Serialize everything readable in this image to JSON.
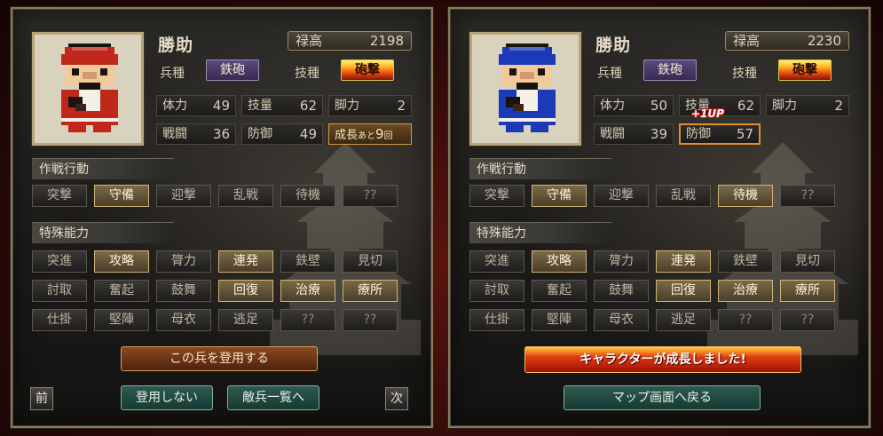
{
  "screens": [
    {
      "name": "勝助",
      "stipend": {
        "label": "禄高",
        "value": "2198"
      },
      "unit_type": {
        "label": "兵種",
        "value": "鉄砲"
      },
      "skill": {
        "label": "技種",
        "value": "砲撃"
      },
      "stats": [
        {
          "label": "体力",
          "value": "49"
        },
        {
          "label": "技量",
          "value": "62"
        },
        {
          "label": "脚力",
          "value": "2"
        },
        {
          "label": "戦闘",
          "value": "36"
        },
        {
          "label": "防御",
          "value": "49"
        }
      ],
      "growth": {
        "text": "成長",
        "small": "あと",
        "count": "9",
        "unit": "回"
      },
      "tactics_title": "作戦行動",
      "tactics": [
        "突撃",
        "守備",
        "迎撃",
        "乱戦",
        "待機",
        "??"
      ],
      "tactics_active": [
        1
      ],
      "abilities_title": "特殊能力",
      "abilities": [
        "突進",
        "攻略",
        "膂力",
        "連発",
        "鉄壁",
        "見切",
        "討取",
        "奮起",
        "鼓舞",
        "回復",
        "治療",
        "療所",
        "仕掛",
        "堅陣",
        "母衣",
        "逃足",
        "??",
        "??"
      ],
      "abilities_active": [
        1,
        3,
        9,
        10,
        11
      ],
      "buttons": {
        "recruit": "この兵を登用する",
        "decline": "登用しない",
        "enemy_list": "敵兵一覧へ",
        "prev": "前",
        "next": "次"
      },
      "colors": {
        "uniform": "#c0281c"
      }
    },
    {
      "name": "勝助",
      "stipend": {
        "label": "禄高",
        "value": "2230"
      },
      "unit_type": {
        "label": "兵種",
        "value": "鉄砲"
      },
      "skill": {
        "label": "技種",
        "value": "砲撃"
      },
      "stats": [
        {
          "label": "体力",
          "value": "50"
        },
        {
          "label": "技量",
          "value": "62"
        },
        {
          "label": "脚力",
          "value": "2"
        },
        {
          "label": "戦闘",
          "value": "39"
        },
        {
          "label": "防御",
          "value": "57"
        }
      ],
      "level_up_badge": "+1UP",
      "tactics_title": "作戦行動",
      "tactics": [
        "突撃",
        "守備",
        "迎撃",
        "乱戦",
        "待機",
        "??"
      ],
      "tactics_active": [
        1,
        4
      ],
      "abilities_title": "特殊能力",
      "abilities": [
        "突進",
        "攻略",
        "膂力",
        "連発",
        "鉄壁",
        "見切",
        "討取",
        "奮起",
        "鼓舞",
        "回復",
        "治療",
        "療所",
        "仕掛",
        "堅陣",
        "母衣",
        "逃足",
        "??",
        "??"
      ],
      "abilities_active": [
        1,
        3,
        9,
        10,
        11
      ],
      "buttons": {
        "growth_banner": "キャラクターが成長しました!",
        "return_map": "マップ画面へ戻る"
      },
      "colors": {
        "uniform": "#1c3ab8"
      }
    }
  ]
}
